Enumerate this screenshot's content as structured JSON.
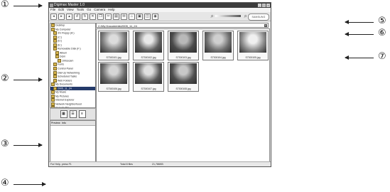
{
  "callouts": [
    "①",
    "②",
    "③",
    "④",
    "⑤",
    "⑥",
    "⑦"
  ],
  "window": {
    "title": "Digimax Master 1.0",
    "controls": [
      "_",
      "□",
      "×"
    ],
    "menu": [
      "File",
      "Edit",
      "View",
      "Tools",
      "Go",
      "Camera",
      "Help"
    ],
    "toolbar_icons": [
      "back-icon",
      "forward-icon",
      "up-icon",
      "rotate-left-icon",
      "rotate-right-icon",
      "delete-icon",
      "copy-icon",
      "cut-icon",
      "print-icon",
      "email-icon",
      "tag-icon",
      "slideshow-icon",
      "view-icon",
      "camera-icon"
    ],
    "brand": "SAMSUNG",
    "zoom_level": 0.5
  },
  "tree": [
    "Desktop",
    "My Computer",
    "3½ Floppy (A:)",
    "(C:)",
    "(D:)",
    "(E:)",
    "Removable Disk (F:)",
    "Album",
    "Dcim",
    "100sscam",
    "Fonts",
    "Control Panel",
    "Dial-Up Networking",
    "Scheduled Tasks",
    "Web Folders",
    "My Documents",
    "2005_11_24",
    "My Music",
    "My Pictures",
    "Internet Explorer",
    "Network Neighborhood",
    "Recycle Bin"
  ],
  "tree_selected_index": 16,
  "preview_tabs": [
    "Preview",
    "Info"
  ],
  "address": "C:\\My Documents\\2005_11_24",
  "thumbs": [
    {
      "label": "S7300101.jpg"
    },
    {
      "label": "S7300102.jpg"
    },
    {
      "label": "S7300103.jpg"
    },
    {
      "label": "S7300104.jpg"
    },
    {
      "label": "S7300105.jpg"
    },
    {
      "label": "S7300106.jpg"
    },
    {
      "label": "S7300107.jpg"
    },
    {
      "label": "S7300108.jpg"
    }
  ],
  "status": {
    "help": "For Help, press F1",
    "total": "Total 8 files",
    "size": "21,786KB"
  }
}
